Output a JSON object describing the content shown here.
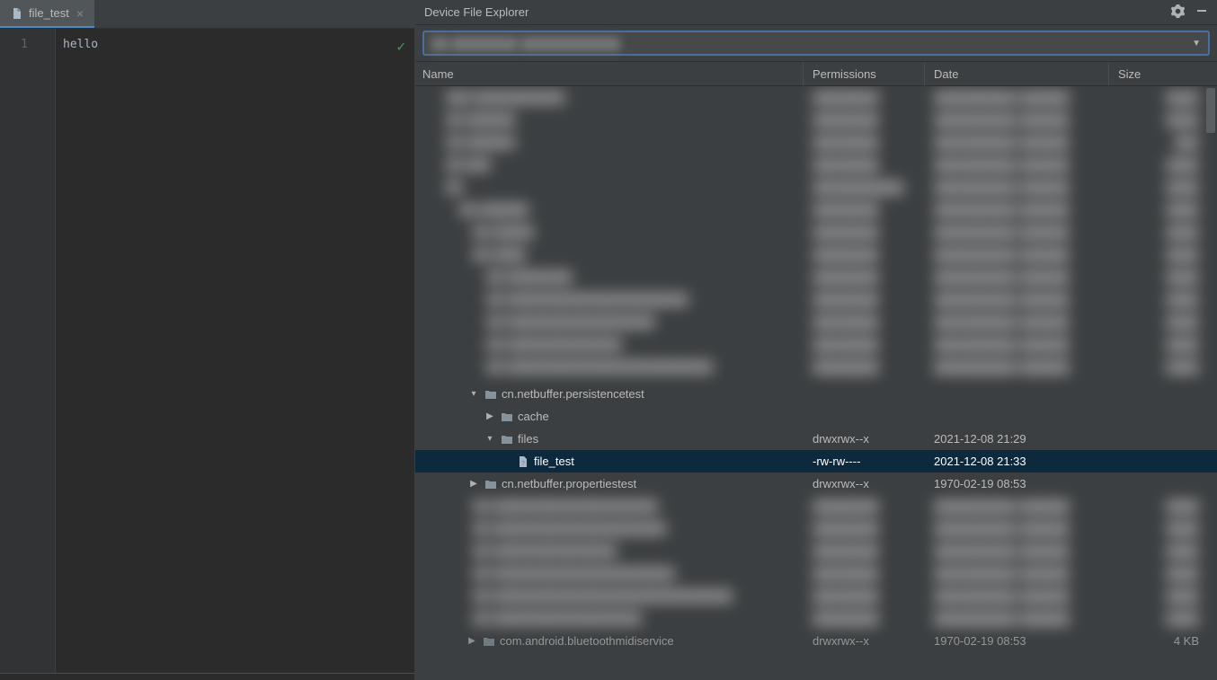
{
  "editor": {
    "tab": {
      "filename": "file_test"
    },
    "gutter_start": "1",
    "content_line1": "hello"
  },
  "explorer": {
    "title": "Device File Explorer",
    "columns": {
      "name": "Name",
      "permissions": "Permissions",
      "date": "Date",
      "size": "Size"
    },
    "rows": [
      {
        "indent": 3,
        "toggle": "expanded",
        "type": "folder",
        "label": "cn.netbuffer.persistencetest",
        "perm": "",
        "date": "",
        "size": "",
        "blurred": false,
        "selected": false
      },
      {
        "indent": 4,
        "toggle": "collapsed",
        "type": "folder",
        "label": "cache",
        "perm": "",
        "date": "",
        "size": "",
        "blurred": false,
        "selected": false
      },
      {
        "indent": 4,
        "toggle": "expanded",
        "type": "folder",
        "label": "files",
        "perm": "drwxrwx--x",
        "date": "2021-12-08 21:29",
        "size": "",
        "blurred": false,
        "selected": false
      },
      {
        "indent": 5,
        "toggle": "none",
        "type": "file",
        "label": "file_test",
        "perm": "-rw-rw----",
        "date": "2021-12-08 21:33",
        "size": "",
        "blurred": false,
        "selected": true
      },
      {
        "indent": 3,
        "toggle": "collapsed",
        "type": "folder",
        "label": "cn.netbuffer.propertiestest",
        "perm": "drwxrwx--x",
        "date": "1970-02-19 08:53",
        "size": "",
        "blurred": false,
        "selected": false
      }
    ],
    "last_row": {
      "indent": 3,
      "toggle": "collapsed",
      "type": "folder",
      "label": "com.android.bluetoothmidiservice",
      "perm": "drwxrwx--x",
      "date": "1970-02-19 08:53",
      "size": "4 KB"
    }
  }
}
